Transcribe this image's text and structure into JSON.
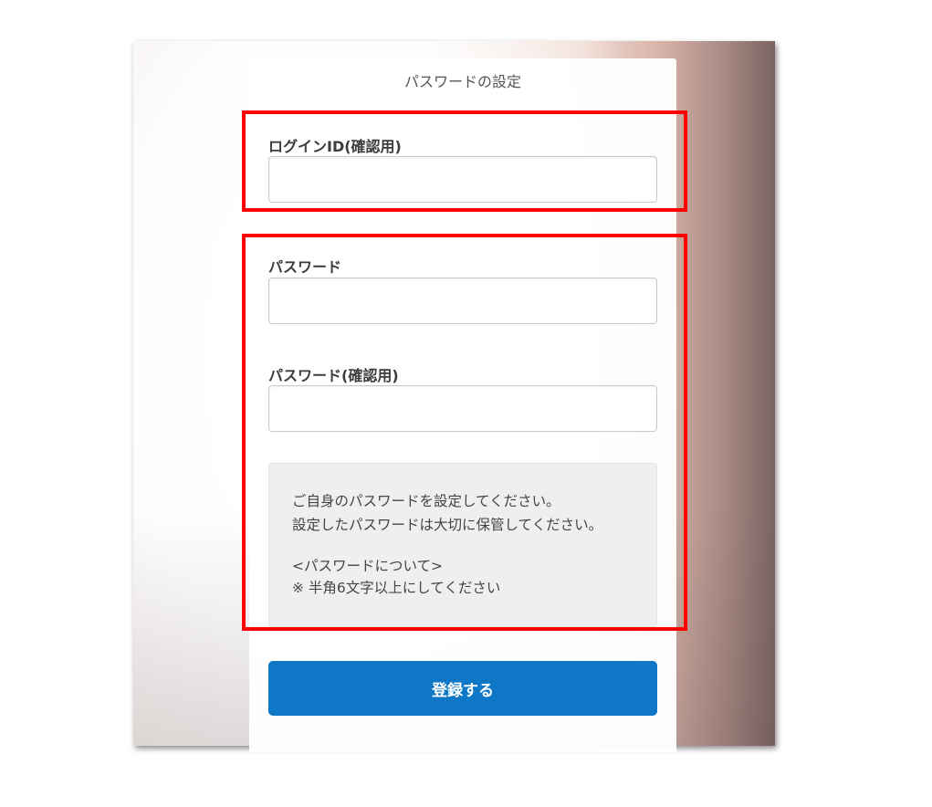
{
  "form": {
    "title": "パスワードの設定",
    "login_id_confirm": {
      "label": "ログインID(確認用)",
      "value": "",
      "placeholder": ""
    },
    "password": {
      "label": "パスワード",
      "value": "",
      "placeholder": ""
    },
    "password_confirm": {
      "label": "パスワード(確認用)",
      "value": "",
      "placeholder": ""
    },
    "note": {
      "line1": "ご自身のパスワードを設定してください。",
      "line2": "設定したパスワードは大切に保管してください。",
      "heading": "<パスワードについて>",
      "rule": "※ 半角6文字以上にしてください"
    },
    "submit_label": "登録する"
  },
  "colors": {
    "accent": "#0e78c6",
    "highlight": "#ff0000"
  }
}
